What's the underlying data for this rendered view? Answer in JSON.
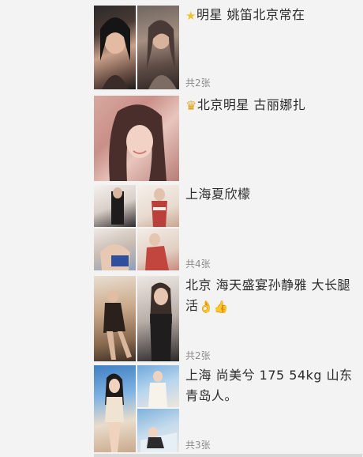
{
  "posts": [
    {
      "prefix_icon": "star-emoji",
      "caption": "明星 姚笛北京常在",
      "count": "共2张",
      "photos": 2
    },
    {
      "prefix_icon": "crown-emoji",
      "caption": "北京明星 古丽娜扎",
      "count": "",
      "photos": 1
    },
    {
      "prefix_icon": "",
      "caption": "上海夏欣檬",
      "count": "共4张",
      "photos": 4
    },
    {
      "prefix_icon": "",
      "caption": "北京 海天盛宴孙静雅 大长腿 活",
      "suffix_icons": "👌👍",
      "count": "共2张",
      "photos": 2
    },
    {
      "prefix_icon": "",
      "caption": "上海 尚美兮 175 54kg 山东青岛人。",
      "count": "共3张",
      "photos": 3
    }
  ],
  "colors": {
    "background": "#f3f3f3",
    "caption_text": "#2c2c2c",
    "count_text": "#8a8a8a"
  }
}
